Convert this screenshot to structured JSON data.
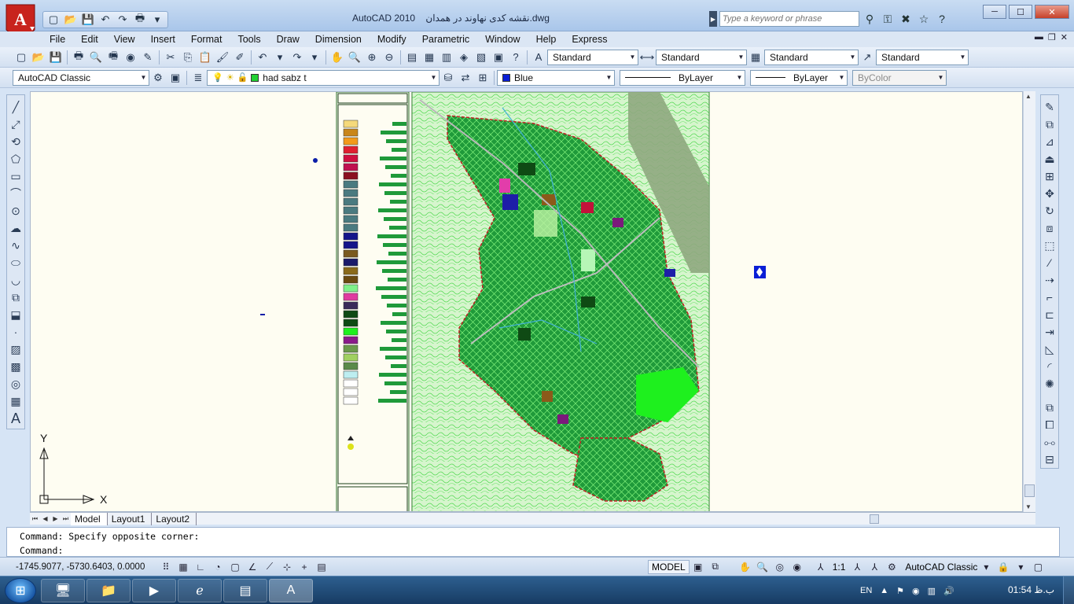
{
  "window": {
    "title_app": "AutoCAD 2010",
    "title_file": "نقشه کدی نهاوند در همدان.dwg",
    "search_placeholder": "Type a keyword or phrase"
  },
  "menu": [
    "File",
    "Edit",
    "View",
    "Insert",
    "Format",
    "Tools",
    "Draw",
    "Dimension",
    "Modify",
    "Parametric",
    "Window",
    "Help",
    "Express"
  ],
  "toolbar": {
    "text_style": "Standard",
    "dim_style": "Standard",
    "table_style": "Standard",
    "multileader_style": "Standard",
    "workspace": "AutoCAD Classic",
    "layer": "had sabz t",
    "color": "Blue",
    "color_hex": "#0a1fd6",
    "linetype": "ByLayer",
    "lineweight": "ByLayer",
    "plot_style": "ByColor"
  },
  "ucs": {
    "y_label": "Y",
    "x_label": "X"
  },
  "tabs": [
    "Model",
    "Layout1",
    "Layout2"
  ],
  "command": {
    "history": "Command: Specify opposite corner:",
    "prompt": "Command:"
  },
  "status": {
    "coords": "-1745.9077, -5730.6403, 0.0000",
    "model": "MODEL",
    "scale": "1:1",
    "workspace": "AutoCAD Classic"
  },
  "taskbar": {
    "language": "EN",
    "time": "01:54 ب.ظ"
  }
}
